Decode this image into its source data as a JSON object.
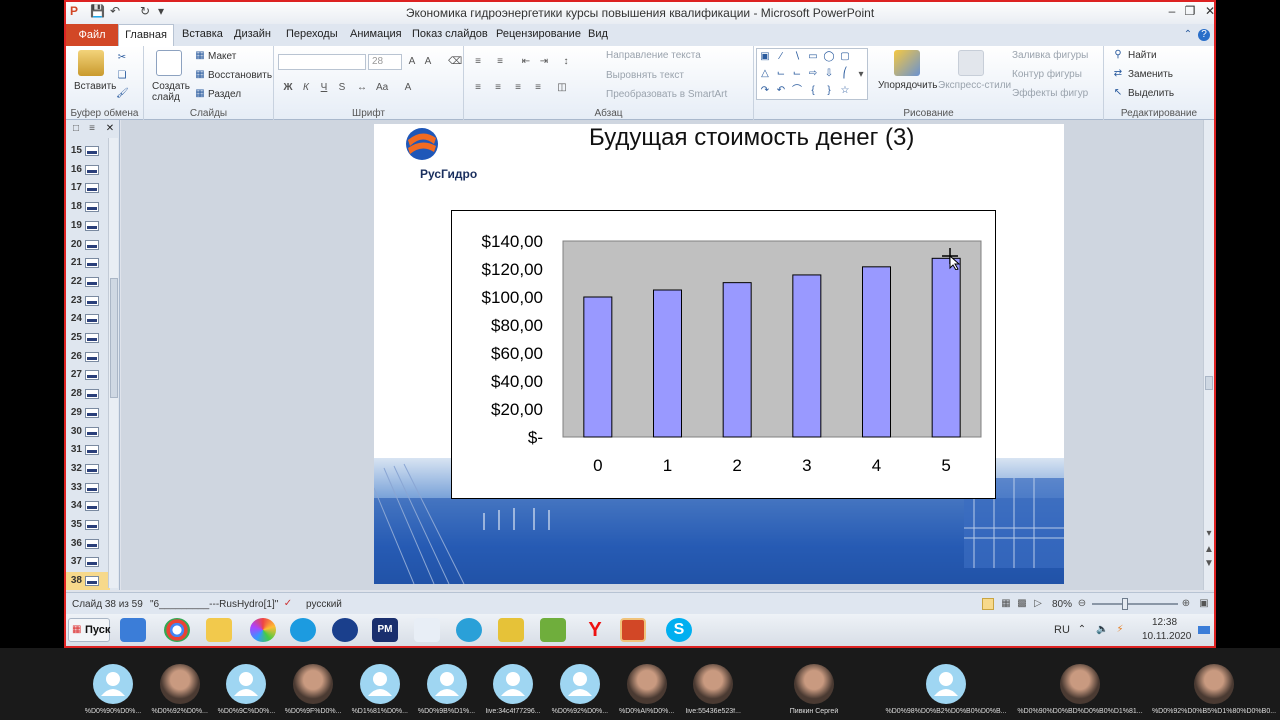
{
  "window": {
    "title": "Экономика гидроэнергетики курсы повышения квалификации  -  Microsoft PowerPoint"
  },
  "tabs": [
    "Файл",
    "Главная",
    "Вставка",
    "Дизайн",
    "Переходы",
    "Анимация",
    "Показ слайдов",
    "Рецензирование",
    "Вид"
  ],
  "ribbon": {
    "clipboard": {
      "label": "Буфер обмена",
      "paste": "Вставить"
    },
    "slides": {
      "label": "Слайды",
      "new_slide": "Создать слайд",
      "layout": "Макет",
      "reset": "Восстановить",
      "section": "Раздел"
    },
    "font": {
      "label": "Шрифт",
      "size": "28"
    },
    "paragraph": {
      "label": "Абзац",
      "text_direction": "Направление текста",
      "align_text": "Выровнять текст",
      "smartart": "Преобразовать в SmartArt"
    },
    "drawing": {
      "label": "Рисование",
      "arrange": "Упорядочить",
      "quick_styles": "Экспресс-стили",
      "fill": "Заливка фигуры",
      "outline": "Контур фигуры",
      "effects": "Эффекты фигур"
    },
    "editing": {
      "label": "Редактирование",
      "find": "Найти",
      "replace": "Заменить",
      "select": "Выделить"
    }
  },
  "thumbnails": [
    "15",
    "16",
    "17",
    "18",
    "19",
    "20",
    "21",
    "22",
    "23",
    "24",
    "25",
    "26",
    "27",
    "28",
    "29",
    "30",
    "31",
    "32",
    "33",
    "34",
    "35",
    "36",
    "37",
    "38"
  ],
  "slide": {
    "title": "Будущая стоимость денег (3)",
    "logo_text": "РусГидро"
  },
  "chart_data": {
    "type": "bar",
    "categories": [
      "0",
      "1",
      "2",
      "3",
      "4",
      "5"
    ],
    "values": [
      100,
      105,
      110.25,
      115.76,
      121.55,
      127.63
    ],
    "yticks": [
      "$140,00",
      "$120,00",
      "$100,00",
      "$80,00",
      "$60,00",
      "$40,00",
      "$20,00",
      "$-"
    ],
    "ylim": [
      0,
      140
    ],
    "bar_color": "#9999ff",
    "plot_bg": "#c0c0c0"
  },
  "status": {
    "slide_info": "Слайд 38 из 59",
    "theme": "\"6_________---RusHydro[1]\"",
    "language": "русский",
    "zoom": "80%"
  },
  "taskbar": {
    "start": "Пуск",
    "lang": "RU",
    "time": "12:38",
    "date": "10.11.2020"
  },
  "participants": [
    {
      "name": "%D0%90%D0%...",
      "photo": false
    },
    {
      "name": "%D0%92%D0%...",
      "photo": true
    },
    {
      "name": "%D0%9C%D0%...",
      "photo": false
    },
    {
      "name": "%D0%9F%D0%...",
      "photo": true
    },
    {
      "name": "%D1%81%D0%...",
      "photo": false
    },
    {
      "name": "%D0%9B%D1%...",
      "photo": false
    },
    {
      "name": "live:34c4f77296...",
      "photo": false
    },
    {
      "name": "%D0%92%D0%...",
      "photo": false
    },
    {
      "name": "%D0%AI%D0%...",
      "photo": true
    },
    {
      "name": "live:55436e523f...",
      "photo": true
    }
  ],
  "participants_wide": [
    {
      "name": "Пивкин Сергей",
      "photo": true
    },
    {
      "name": "%D0%98%D0%B2%D0%B0%D0%B...",
      "photo": false
    },
    {
      "name": "%D0%90%D0%BD%D0%B0%D1%81...",
      "photo": true
    },
    {
      "name": "%D0%92%D0%B5%D1%80%D0%B0...",
      "photo": true
    }
  ]
}
